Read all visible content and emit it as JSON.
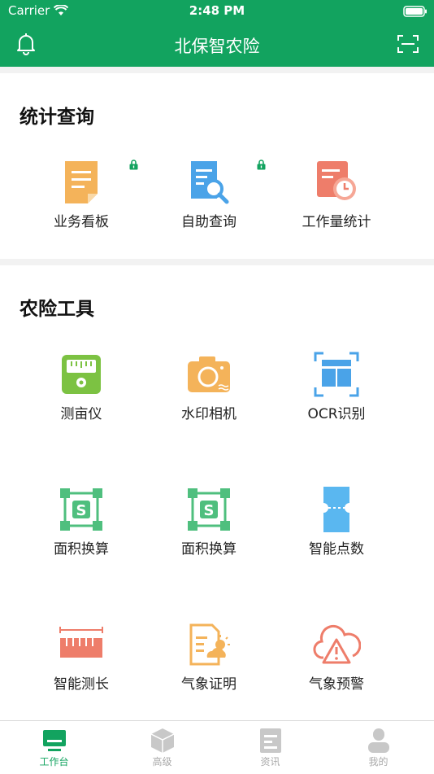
{
  "status": {
    "carrier": "Carrier",
    "time": "2:48 PM"
  },
  "nav": {
    "title": "北保智农险"
  },
  "stats": {
    "title": "统计查询",
    "items": [
      {
        "label": "业务看板",
        "icon": "document-icon",
        "locked": true
      },
      {
        "label": "自助查询",
        "icon": "search-document-icon",
        "locked": true
      },
      {
        "label": "工作量统计",
        "icon": "clock-document-icon",
        "locked": false
      }
    ]
  },
  "tools": {
    "title": "农险工具",
    "items": [
      {
        "label": "测亩仪",
        "icon": "meter-icon"
      },
      {
        "label": "水印相机",
        "icon": "camera-icon"
      },
      {
        "label": "OCR识别",
        "icon": "ocr-scan-icon"
      },
      {
        "label": "面积换算",
        "icon": "area-convert-icon"
      },
      {
        "label": "面积换算",
        "icon": "area-convert-icon"
      },
      {
        "label": "智能点数",
        "icon": "count-card-icon"
      },
      {
        "label": "智能测长",
        "icon": "ruler-icon"
      },
      {
        "label": "气象证明",
        "icon": "weather-document-icon"
      },
      {
        "label": "气象预警",
        "icon": "weather-warning-icon"
      }
    ]
  },
  "tabs": [
    {
      "label": "工作台",
      "active": true
    },
    {
      "label": "高级",
      "active": false
    },
    {
      "label": "资讯",
      "active": false
    },
    {
      "label": "我的",
      "active": false
    }
  ],
  "colors": {
    "brand": "#12a35f",
    "orange": "#f4b35a",
    "blue": "#4aa3e8",
    "red": "#ee7d6a",
    "green": "#4fbf7e"
  }
}
